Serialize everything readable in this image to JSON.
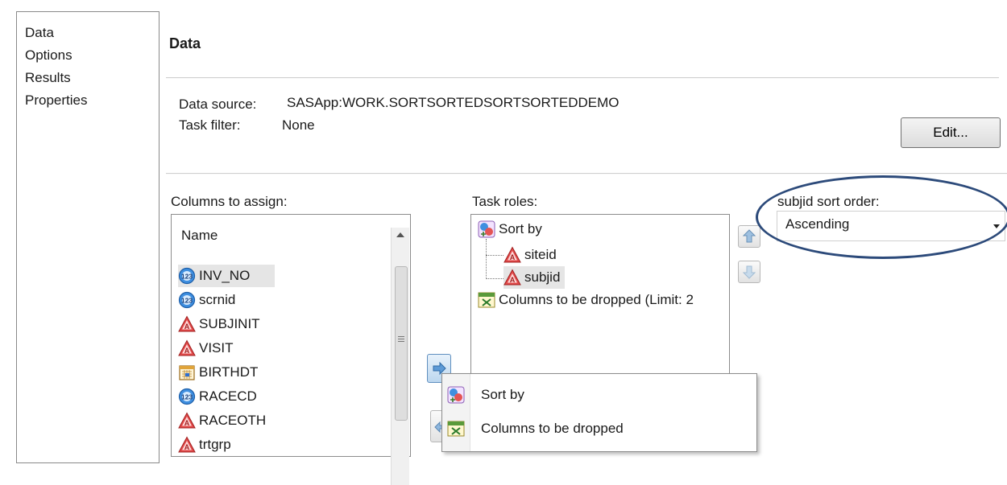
{
  "nav": {
    "items": [
      "Data",
      "Options",
      "Results",
      "Properties"
    ]
  },
  "page": {
    "title": "Data"
  },
  "source": {
    "data_source_label": "Data source:",
    "data_source_value": "SASApp:WORK.SORTSORTEDSORTSORTEDDEMO",
    "task_filter_label": "Task filter:",
    "task_filter_value": "None",
    "edit_label": "Edit..."
  },
  "columns": {
    "label": "Columns to assign:",
    "header": "Name",
    "items": [
      {
        "name": "INV_NO",
        "icon": "numeric-icon",
        "selected": true
      },
      {
        "name": "scrnid",
        "icon": "numeric-icon"
      },
      {
        "name": "SUBJINIT",
        "icon": "character-icon"
      },
      {
        "name": "VISIT",
        "icon": "character-icon"
      },
      {
        "name": "BIRTHDT",
        "icon": "date-icon"
      },
      {
        "name": "RACECD",
        "icon": "numeric-icon"
      },
      {
        "name": "RACEOTH",
        "icon": "character-icon"
      },
      {
        "name": "trtgrp",
        "icon": "character-icon"
      }
    ]
  },
  "roles": {
    "label": "Task roles:",
    "sort_by": "Sort by",
    "sort_children": [
      "siteid",
      "subjid"
    ],
    "dropped": "Columns to be dropped  (Limit: 2"
  },
  "sort_order": {
    "label": "subjid sort order:",
    "value": "Ascending"
  },
  "context_menu": {
    "items": [
      "Sort by",
      "Columns to be dropped"
    ]
  },
  "colors": {
    "ellipse": "#2c4a7a",
    "selection": "#e5e5e5",
    "numeric_blue": "#2f7fd6",
    "char_red": "#d23b3b"
  }
}
